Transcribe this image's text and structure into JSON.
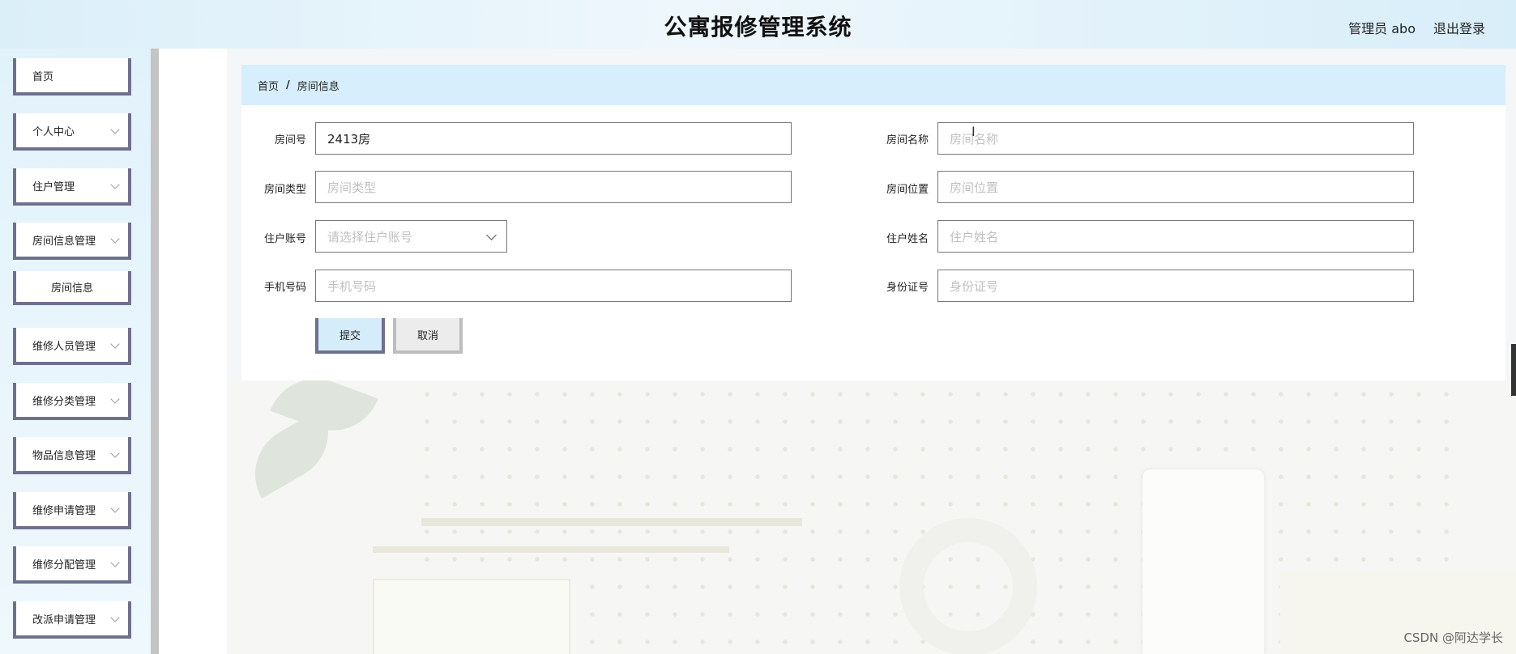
{
  "header": {
    "title": "公寓报修管理系统",
    "user": "管理员 abo",
    "logout": "退出登录"
  },
  "sidebar": {
    "items": [
      {
        "label": "首页",
        "expandable": false
      },
      {
        "label": "个人中心",
        "expandable": true
      },
      {
        "label": "住户管理",
        "expandable": true
      },
      {
        "label": "房间信息管理",
        "expandable": true,
        "expanded": true,
        "children": [
          {
            "label": "房间信息",
            "active": true
          }
        ]
      },
      {
        "label": "维修人员管理",
        "expandable": true
      },
      {
        "label": "维修分类管理",
        "expandable": true
      },
      {
        "label": "物品信息管理",
        "expandable": true
      },
      {
        "label": "维修申请管理",
        "expandable": true
      },
      {
        "label": "维修分配管理",
        "expandable": true
      },
      {
        "label": "改派申请管理",
        "expandable": true
      }
    ]
  },
  "breadcrumb": {
    "home": "首页",
    "separator": "/",
    "current": "房间信息"
  },
  "form": {
    "room_no": {
      "label": "房间号",
      "value": "2413房",
      "placeholder": "房间号"
    },
    "room_name": {
      "label": "房间名称",
      "value": "",
      "placeholder": "房间名称"
    },
    "room_type": {
      "label": "房间类型",
      "value": "",
      "placeholder": "房间类型"
    },
    "room_location": {
      "label": "房间位置",
      "value": "",
      "placeholder": "房间位置"
    },
    "resident_account": {
      "label": "住户账号",
      "value": "",
      "placeholder": "请选择住户账号"
    },
    "resident_name": {
      "label": "住户姓名",
      "value": "",
      "placeholder": "住户姓名"
    },
    "phone": {
      "label": "手机号码",
      "value": "",
      "placeholder": "手机号码"
    },
    "id_card": {
      "label": "身份证号",
      "value": "",
      "placeholder": "身份证号"
    },
    "submit_label": "提交",
    "cancel_label": "取消"
  },
  "watermark": "CSDN @阿达学长",
  "colors": {
    "header_bg": "#dbeff9",
    "breadcrumb_bg": "#d7eefc",
    "menu_border": "#6f7090",
    "submit_bg": "#d5ecfb"
  }
}
